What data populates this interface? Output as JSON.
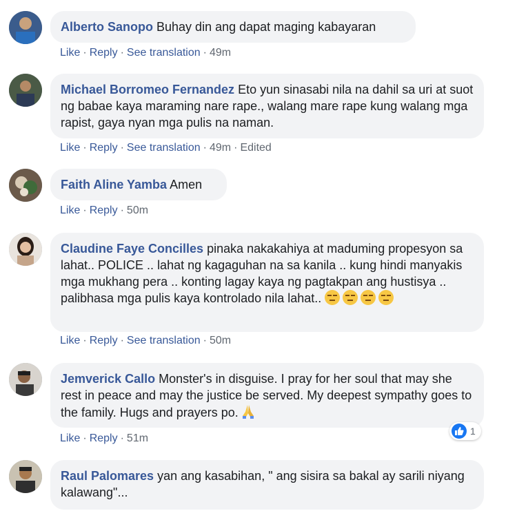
{
  "comments": [
    {
      "author": "Alberto Sanopo",
      "text": "Buhay din ang dapat maging kabayaran",
      "actions": {
        "like": "Like",
        "reply": "Reply",
        "translate": "See translation",
        "time": "49m"
      }
    },
    {
      "author": "Michael Borromeo Fernandez",
      "text": "Eto yun sinasabi nila na dahil sa uri at suot ng babae kaya maraming nare rape., walang mare rape kung walang mga rapist, gaya nyan mga pulis na naman.",
      "actions": {
        "like": "Like",
        "reply": "Reply",
        "translate": "See translation",
        "time": "49m",
        "edited": "Edited"
      }
    },
    {
      "author": "Faith Aline Yamba",
      "text": "Amen",
      "actions": {
        "like": "Like",
        "reply": "Reply",
        "time": "50m"
      }
    },
    {
      "author": "Claudine Faye Concilles",
      "text": "pinaka nakakahiya at maduming propesyon sa lahat.. POLICE .. lahat ng kagaguhan na sa kanila .. kung hindi manyakis mga mukhang pera .. konting lagay kaya ng pagtakpan ang hustisya .. palibhasa mga pulis kaya kontrolado nila lahat..",
      "emoji": [
        "unamused-face-icon",
        "unamused-face-icon",
        "unamused-face-icon",
        "unamused-face-icon"
      ],
      "actions": {
        "like": "Like",
        "reply": "Reply",
        "translate": "See translation",
        "time": "50m"
      }
    },
    {
      "author": "Jemverick Callo",
      "text": "Monster's in disguise. I pray for her soul that may she rest in peace and may the justice be served. My deepest sympathy goes to the family. Hugs and prayers po.",
      "emoji": [
        "folded-hands-icon"
      ],
      "actions": {
        "like": "Like",
        "reply": "Reply",
        "time": "51m"
      },
      "reactions": {
        "icon": "like-reaction-icon",
        "count": "1"
      }
    },
    {
      "author": "Raul Palomares",
      "text": "yan ang kasabihan, \" ang sisira sa bakal ay sarili niyang kalawang\"..."
    }
  ],
  "colors": {
    "author": "#385898",
    "bubble": "#f2f3f5",
    "meta": "#606770",
    "like_badge": "#1877f2"
  }
}
